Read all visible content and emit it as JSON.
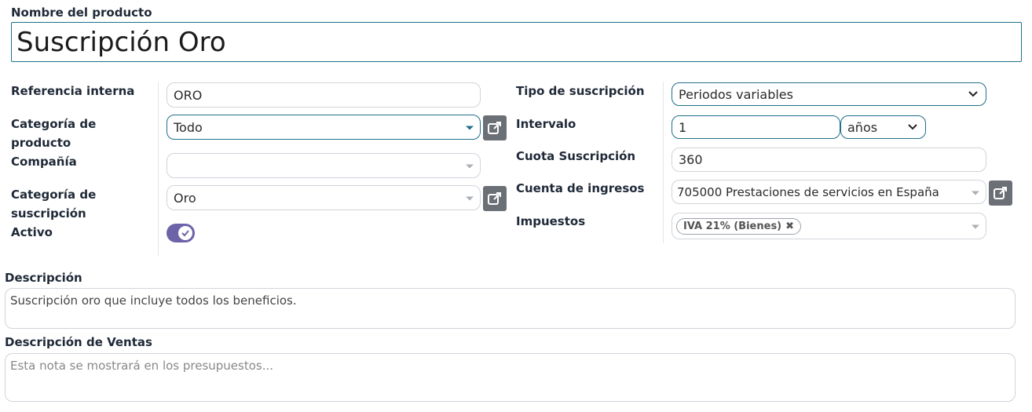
{
  "product_name": {
    "label": "Nombre del producto",
    "value": "Suscripción Oro"
  },
  "left": {
    "ref_label": "Referencia interna",
    "ref_value": "ORO",
    "cat_label_1": "Categoría de",
    "cat_label_2": "producto",
    "cat_value": "Todo",
    "company_label": "Compañía",
    "company_value": "",
    "subcat_label_1": "Categoría de",
    "subcat_label_2": "suscripción",
    "subcat_value": "Oro",
    "active_label": "Activo",
    "active_on": true
  },
  "right": {
    "type_label": "Tipo de suscripción",
    "type_value": "Periodos variables",
    "interval_label": "Intervalo",
    "interval_value": "1",
    "interval_unit": "años",
    "fee_label": "Cuota Suscripción",
    "fee_value": "360",
    "income_label": "Cuenta de ingresos",
    "income_value": "705000 Prestaciones de servicios en España",
    "taxes_label": "Impuestos",
    "tax_tag": "IVA 21% (Bienes)"
  },
  "description": {
    "label": "Descripción",
    "value": "Suscripción oro que incluye todos los beneficios."
  },
  "sales_description": {
    "label": "Descripción de Ventas",
    "placeholder": "Esta nota se mostrará en los presupuestos..."
  },
  "colors": {
    "accent": "#1f6f8b",
    "toggle": "#6c63a8",
    "button": "#6b6f76"
  }
}
